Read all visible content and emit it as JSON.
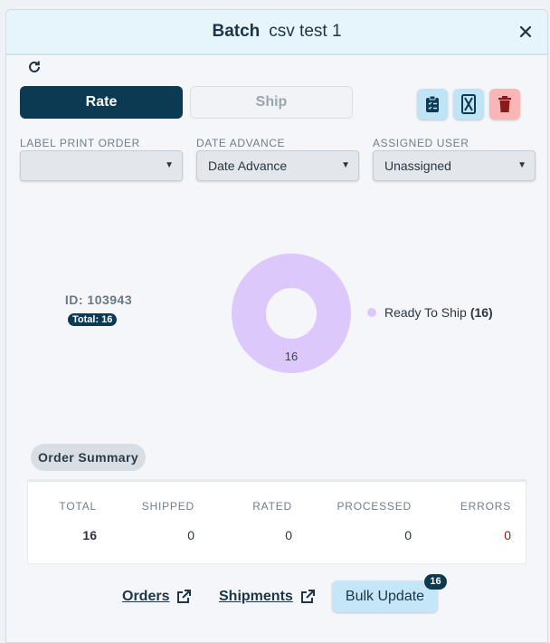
{
  "header": {
    "label": "Batch",
    "name": "csv test 1"
  },
  "tabs": {
    "rate": "Rate",
    "ship": "Ship"
  },
  "fields": [
    {
      "label": "LABEL PRINT ORDER",
      "value": ""
    },
    {
      "label": "DATE ADVANCE",
      "value": "Date Advance"
    },
    {
      "label": "ASSIGNED USER",
      "value": "Unassigned"
    }
  ],
  "batch": {
    "id_text": "ID: 103943",
    "total_text": "Total: 16"
  },
  "chart_data": {
    "type": "pie",
    "categories": [
      "Ready To Ship"
    ],
    "values": [
      16
    ],
    "legend": [
      {
        "name": "Ready To Ship",
        "count": "(16)"
      }
    ],
    "slice_labels": [
      "16"
    ],
    "colors": [
      "#dcc8fb"
    ],
    "donut": true
  },
  "summary": {
    "title": "Order Summary",
    "columns": [
      {
        "header": "TOTAL",
        "value": "16"
      },
      {
        "header": "SHIPPED",
        "value": "0"
      },
      {
        "header": "RATED",
        "value": "0"
      },
      {
        "header": "PROCESSED",
        "value": "0"
      },
      {
        "header": "ERRORS",
        "value": "0"
      }
    ]
  },
  "footer": {
    "orders_label": "Orders",
    "shipments_label": "Shipments",
    "bulk_label": "Bulk Update",
    "bulk_count": "16"
  },
  "colors": {
    "primary": "#0b3a52",
    "accent": "#c4e6f8",
    "danger": "#8b1a1a",
    "error_value": "#8b1a1a",
    "chart_slice": "#dcc8fb"
  }
}
